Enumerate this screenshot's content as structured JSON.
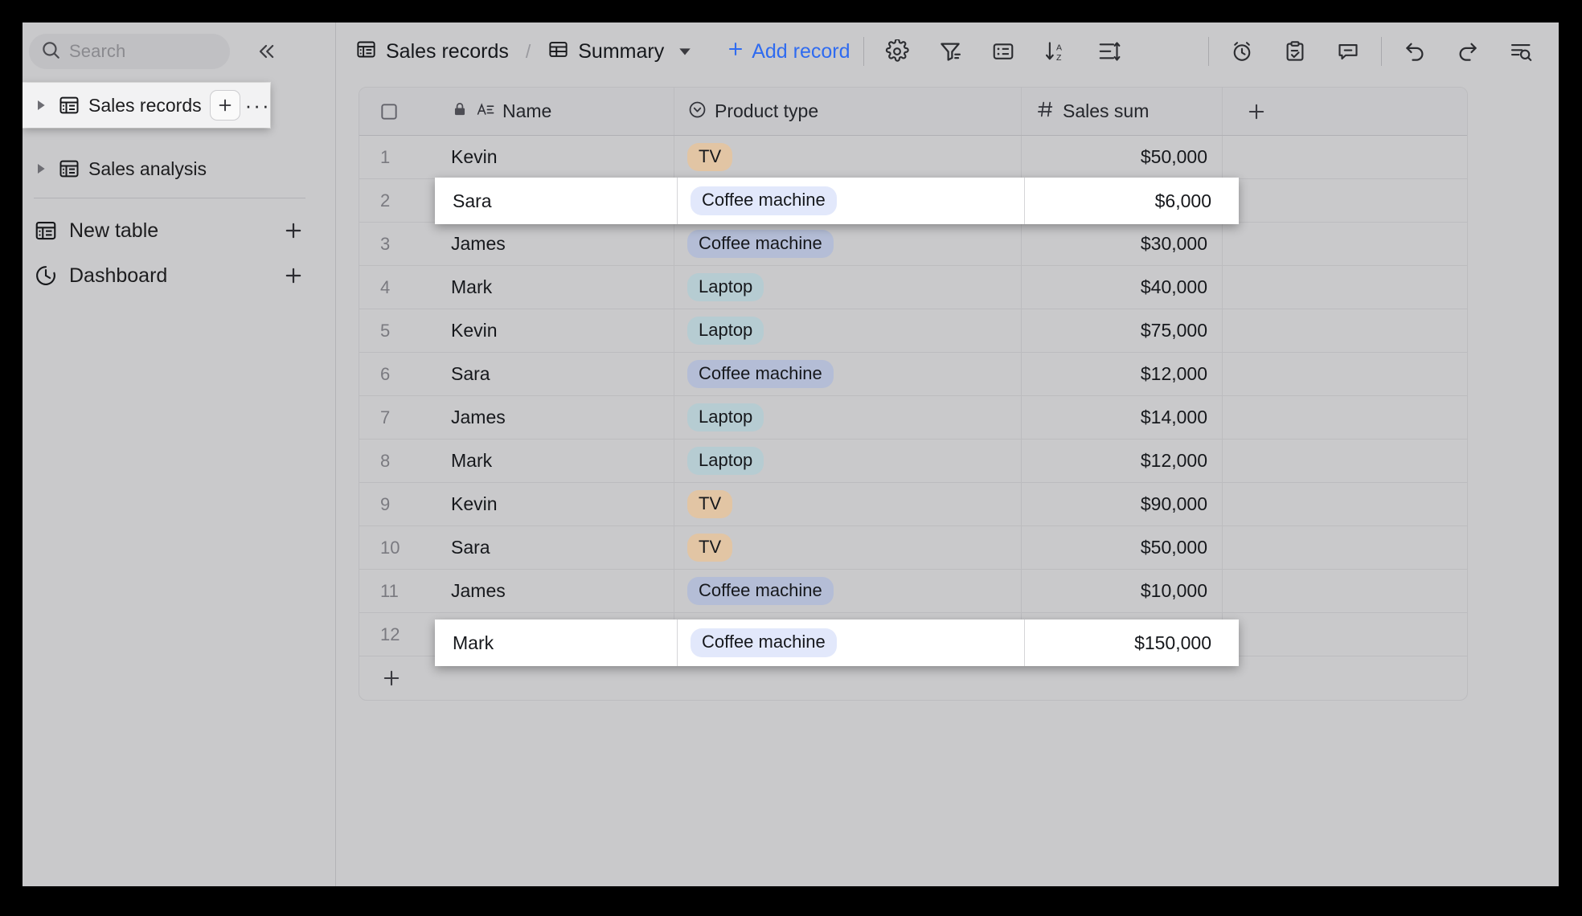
{
  "sidebar": {
    "search": {
      "placeholder": "Search",
      "value": ""
    },
    "collapse_label": "«",
    "tables": [
      {
        "label": "Sales records",
        "selected": true,
        "add_label": "+",
        "more_label": "···"
      },
      {
        "label": "Sales analysis",
        "selected": false
      }
    ],
    "actions": [
      {
        "label": "New table",
        "icon": "table-icon",
        "plus": "+"
      },
      {
        "label": "Dashboard",
        "icon": "dashboard-icon",
        "plus": "+"
      }
    ]
  },
  "toolbar": {
    "breadcrumb": [
      {
        "label": "Sales records",
        "icon": "table-icon"
      },
      {
        "label": "Summary",
        "icon": "grid-icon",
        "has_caret": true
      }
    ],
    "separator": "/",
    "add_record_label": "Add record",
    "add_record_plus": "+",
    "left_tools": [
      {
        "name": "settings-icon"
      },
      {
        "name": "filter-icon"
      },
      {
        "name": "group-icon"
      },
      {
        "name": "sort-az-icon"
      },
      {
        "name": "row-height-icon"
      }
    ],
    "mid_tools": [
      {
        "name": "reminder-icon"
      },
      {
        "name": "task-icon"
      },
      {
        "name": "comment-icon"
      }
    ],
    "right_tools": [
      {
        "name": "undo-icon"
      },
      {
        "name": "redo-icon"
      },
      {
        "name": "find-in-table-icon"
      }
    ],
    "accent_color": "#2f6bf0"
  },
  "table": {
    "columns": [
      {
        "label": "Name",
        "type_icon": "text-field-icon",
        "locked": true
      },
      {
        "label": "Product type",
        "type_icon": "single-select-icon",
        "locked": false
      },
      {
        "label": "Sales sum",
        "type_icon": "number-icon",
        "locked": false
      }
    ],
    "add_column_label": "+",
    "add_row_label": "+",
    "select_all_label": "",
    "tag_colors": {
      "TV": "#e2c5a4",
      "Coffee machine": "#b4bdd6",
      "Coffee machine_light": "#e2e8fb",
      "Laptop": "#b6ccd2"
    },
    "rows": [
      {
        "index": "1",
        "name": "Kevin",
        "product": "TV",
        "sum": "$50,000",
        "highlighted": false
      },
      {
        "index": "2",
        "name": "Sara",
        "product": "Coffee machine",
        "sum": "$6,000",
        "highlighted": true
      },
      {
        "index": "3",
        "name": "James",
        "product": "Coffee machine",
        "sum": "$30,000",
        "highlighted": false
      },
      {
        "index": "4",
        "name": "Mark",
        "product": "Laptop",
        "sum": "$40,000",
        "highlighted": false
      },
      {
        "index": "5",
        "name": "Kevin",
        "product": "Laptop",
        "sum": "$75,000",
        "highlighted": false
      },
      {
        "index": "6",
        "name": "Sara",
        "product": "Coffee machine",
        "sum": "$12,000",
        "highlighted": false
      },
      {
        "index": "7",
        "name": "James",
        "product": "Laptop",
        "sum": "$14,000",
        "highlighted": false
      },
      {
        "index": "8",
        "name": "Mark",
        "product": "Laptop",
        "sum": "$12,000",
        "highlighted": false
      },
      {
        "index": "9",
        "name": "Kevin",
        "product": "TV",
        "sum": "$90,000",
        "highlighted": false
      },
      {
        "index": "10",
        "name": "Sara",
        "product": "TV",
        "sum": "$50,000",
        "highlighted": false
      },
      {
        "index": "11",
        "name": "James",
        "product": "Coffee machine",
        "sum": "$10,000",
        "highlighted": false
      },
      {
        "index": "12",
        "name": "Mark",
        "product": "Coffee machine",
        "sum": "$150,000",
        "highlighted": true
      }
    ]
  }
}
